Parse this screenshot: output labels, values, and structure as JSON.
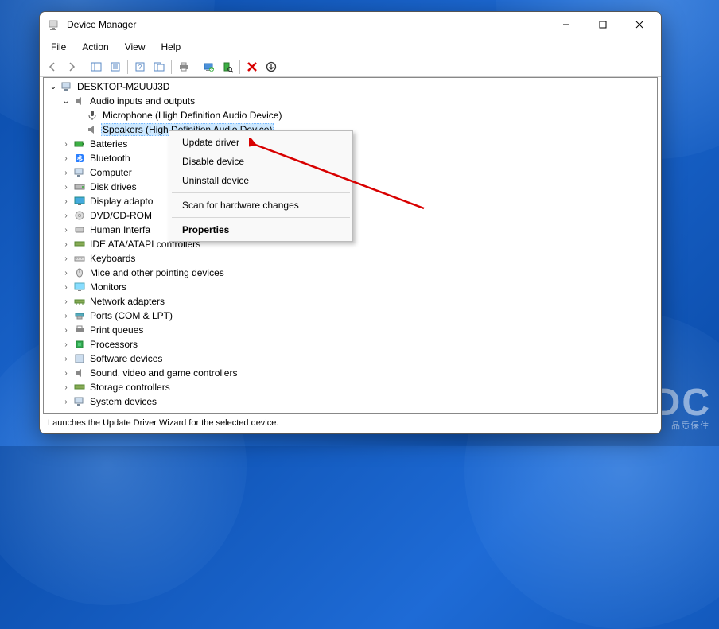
{
  "window": {
    "title": "Device Manager"
  },
  "menubar": [
    "File",
    "Action",
    "View",
    "Help"
  ],
  "tree": {
    "root": "DESKTOP-M2UUJ3D",
    "audio": {
      "label": "Audio inputs and outputs",
      "microphone": "Microphone (High Definition Audio Device)",
      "speakers": "Speakers (High Definition Audio Device)"
    },
    "items": [
      "Batteries",
      "Bluetooth",
      "Computer",
      "Disk drives",
      "Display adapto",
      "DVD/CD-ROM",
      "Human Interfa",
      "IDE ATA/ATAPI controllers",
      "Keyboards",
      "Mice and other pointing devices",
      "Monitors",
      "Network adapters",
      "Ports (COM & LPT)",
      "Print queues",
      "Processors",
      "Software devices",
      "Sound, video and game controllers",
      "Storage controllers",
      "System devices"
    ]
  },
  "context_menu": {
    "update": "Update driver",
    "disable": "Disable device",
    "uninstall": "Uninstall device",
    "scan": "Scan for hardware changes",
    "properties": "Properties"
  },
  "statusbar": "Launches the Update Driver Wizard for the selected device.",
  "watermark": {
    "main": "DC",
    "sub": "品质保住"
  }
}
